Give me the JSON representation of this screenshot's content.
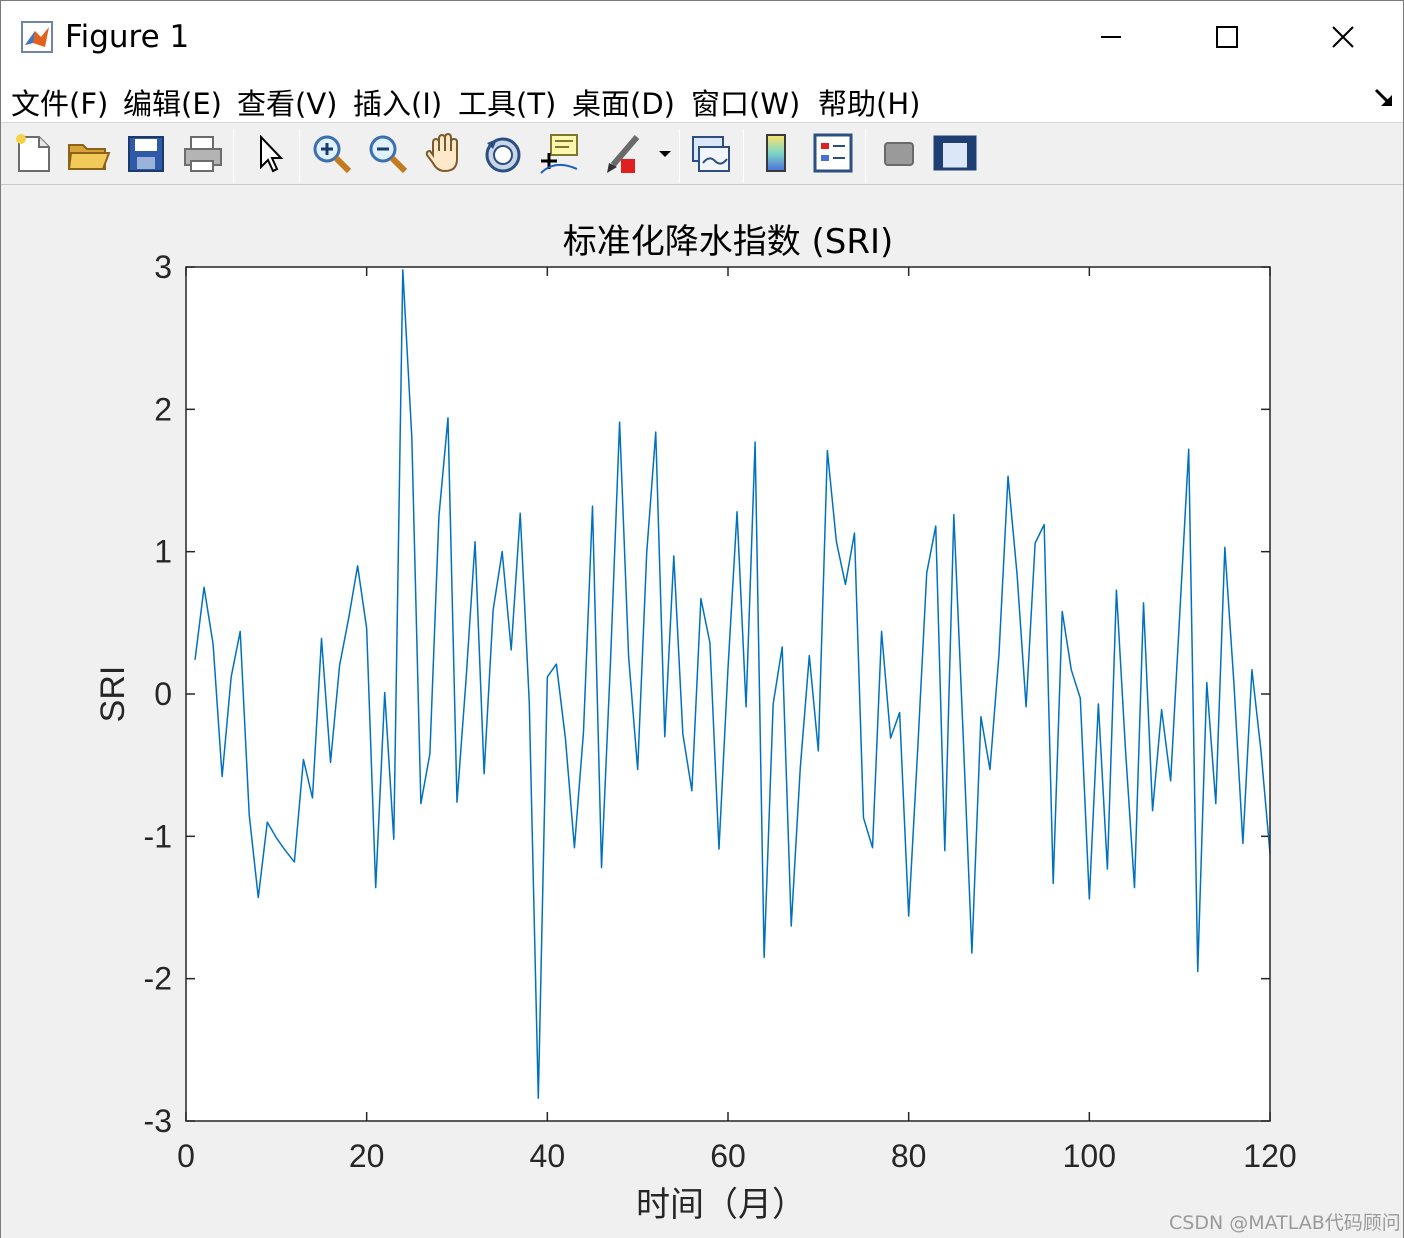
{
  "window": {
    "title": "Figure 1",
    "icon": "matlab-icon",
    "controls": [
      "minimize-icon",
      "maximize-icon",
      "close-icon"
    ]
  },
  "menu": {
    "items": [
      "文件(F)",
      "编辑(E)",
      "查看(V)",
      "插入(I)",
      "工具(T)",
      "桌面(D)",
      "窗口(W)",
      "帮助(H)"
    ],
    "dock_icon": "dock-arrow-icon"
  },
  "toolbar": {
    "icons": [
      "new-figure-icon",
      "open-file-icon",
      "save-icon",
      "print-icon",
      "edit-plot-arrow-icon",
      "zoom-in-icon",
      "zoom-out-icon",
      "pan-hand-icon",
      "rotate-3d-icon",
      "data-cursor-icon",
      "brush-icon",
      "dropdown-arrow-icon",
      "link-plot-icon",
      "colorbar-icon",
      "legend-icon",
      "hide-plot-tools-icon",
      "show-plot-tools-icon"
    ]
  },
  "chart_data": {
    "type": "line",
    "title": "标准化降水指数 (SRI)",
    "xlabel": "时间（月）",
    "ylabel": "SRI",
    "xlim": [
      0,
      120
    ],
    "ylim": [
      -3,
      3
    ],
    "xticks": [
      0,
      20,
      40,
      60,
      80,
      100,
      120
    ],
    "yticks": [
      -3,
      -2,
      -1,
      0,
      1,
      2,
      3
    ],
    "line_color": "#0072bd",
    "grid": false,
    "series": [
      {
        "x": [
          1,
          2,
          3,
          4,
          5,
          6,
          7,
          8,
          9,
          10,
          11,
          12,
          13,
          14,
          15,
          16,
          17,
          18,
          19,
          20,
          21,
          22,
          23,
          24,
          25,
          26,
          27,
          28,
          29,
          30,
          31,
          32,
          33,
          34,
          35,
          36,
          37,
          38,
          39,
          40,
          41,
          42,
          43,
          44,
          45,
          46,
          47,
          48,
          49,
          50,
          51,
          52,
          53,
          54,
          55,
          56,
          57,
          58,
          59,
          60,
          61,
          62,
          63,
          64,
          65,
          66,
          67,
          68,
          69,
          70,
          71,
          72,
          73,
          74,
          75,
          76,
          77,
          78,
          79,
          80,
          81,
          82,
          83,
          84,
          85,
          86,
          87,
          88,
          89,
          90,
          91,
          92,
          93,
          94,
          95,
          96,
          97,
          98,
          99,
          100,
          101,
          102,
          103,
          104,
          105,
          106,
          107,
          108,
          109,
          110,
          111,
          112,
          113,
          114,
          115,
          116,
          117,
          118,
          119,
          120
        ],
        "values": [
          0.24,
          0.75,
          0.35,
          -0.58,
          0.12,
          0.44,
          -0.85,
          -1.43,
          -0.9,
          -1.01,
          -1.1,
          -1.18,
          -0.46,
          -0.73,
          0.39,
          -0.48,
          0.2,
          0.53,
          0.9,
          0.46,
          -1.36,
          0.01,
          -1.02,
          2.98,
          1.8,
          -0.77,
          -0.42,
          1.25,
          1.94,
          -0.76,
          0.1,
          1.07,
          -0.56,
          0.59,
          1.0,
          0.31,
          1.27,
          -0.06,
          -2.84,
          0.12,
          0.21,
          -0.31,
          -1.08,
          -0.27,
          1.32,
          -1.22,
          0.24,
          1.91,
          0.26,
          -0.53,
          0.99,
          1.84,
          -0.3,
          0.97,
          -0.28,
          -0.68,
          0.67,
          0.36,
          -1.09,
          0.18,
          1.28,
          -0.09,
          1.77,
          -1.85,
          -0.07,
          0.33,
          -1.63,
          -0.52,
          0.27,
          -0.4,
          1.71,
          1.07,
          0.77,
          1.13,
          -0.87,
          -1.08,
          0.44,
          -0.31,
          -0.13,
          -1.56,
          -0.39,
          0.85,
          1.18,
          -1.1,
          1.26,
          -0.24,
          -1.82,
          -0.16,
          -0.53,
          0.28,
          1.53,
          0.84,
          -0.09,
          1.06,
          1.19,
          -1.33,
          0.58,
          0.17,
          -0.03,
          -1.44,
          -0.07,
          -1.23,
          0.73,
          -0.39,
          -1.36,
          0.64,
          -0.82,
          -0.11,
          -0.61,
          0.55,
          1.72,
          -1.95,
          0.08,
          -0.77,
          1.03,
          0.08,
          -1.05,
          0.17,
          -0.4,
          -1.12
        ]
      }
    ]
  },
  "watermark": "CSDN @MATLAB代码顾问"
}
